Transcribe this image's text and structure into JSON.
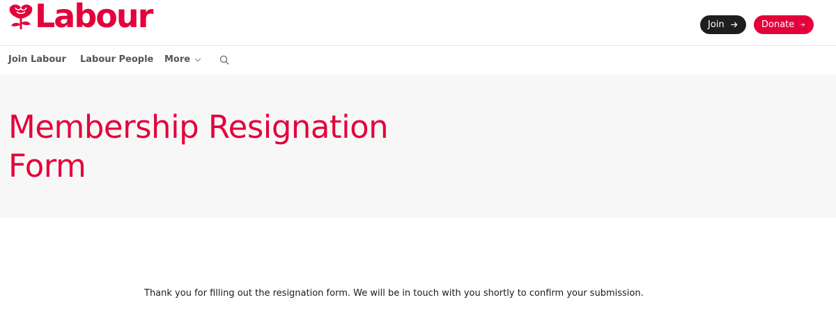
{
  "brand": {
    "name": "Labour",
    "color": "#e4003b",
    "icon": "rose-icon"
  },
  "header": {
    "join_label": "Join",
    "donate_label": "Donate"
  },
  "nav": {
    "items": [
      {
        "label": "Join Labour"
      },
      {
        "label": "Labour People"
      },
      {
        "label": "More"
      }
    ],
    "search_icon": "search-icon"
  },
  "hero": {
    "title": "Membership Resignation Form",
    "background": "#f7f7f7"
  },
  "content": {
    "message": "Thank you for filling out the resignation form. We will be in touch with you shortly to confirm your submission."
  }
}
